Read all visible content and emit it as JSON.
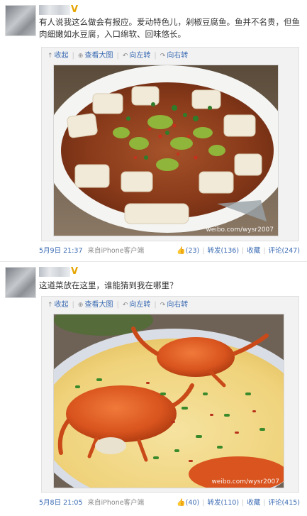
{
  "posts": [
    {
      "verified_badge": "V",
      "text": "有人说我这么做会有报应。爱动特色儿，剁椒豆腐鱼。鱼并不名贵，但鱼肉细嫩如水豆腐，入口绵软、回味悠长。",
      "toolbar": {
        "collapse": "收起",
        "view_large": "查看大图",
        "rotate_left": "向左转",
        "rotate_right": "向右转"
      },
      "watermark": "weibo.com/wysr2007",
      "date": "5月9日 21:37",
      "source": "来自iPhone客户端",
      "likes": "(23)",
      "repost": "转发(136)",
      "favorite": "收藏",
      "comment": "评论(247)"
    },
    {
      "verified_badge": "V",
      "text": "这道菜放在这里，谁能猜到我在哪里？",
      "toolbar": {
        "collapse": "收起",
        "view_large": "查看大图",
        "rotate_left": "向左转",
        "rotate_right": "向右转"
      },
      "watermark": "weibo.com/wysr2007",
      "date": "5月8日 21:05",
      "source": "来自iPhone客户端",
      "likes": "(40)",
      "repost": "转发(110)",
      "favorite": "收藏",
      "comment": "评论(415)"
    }
  ]
}
